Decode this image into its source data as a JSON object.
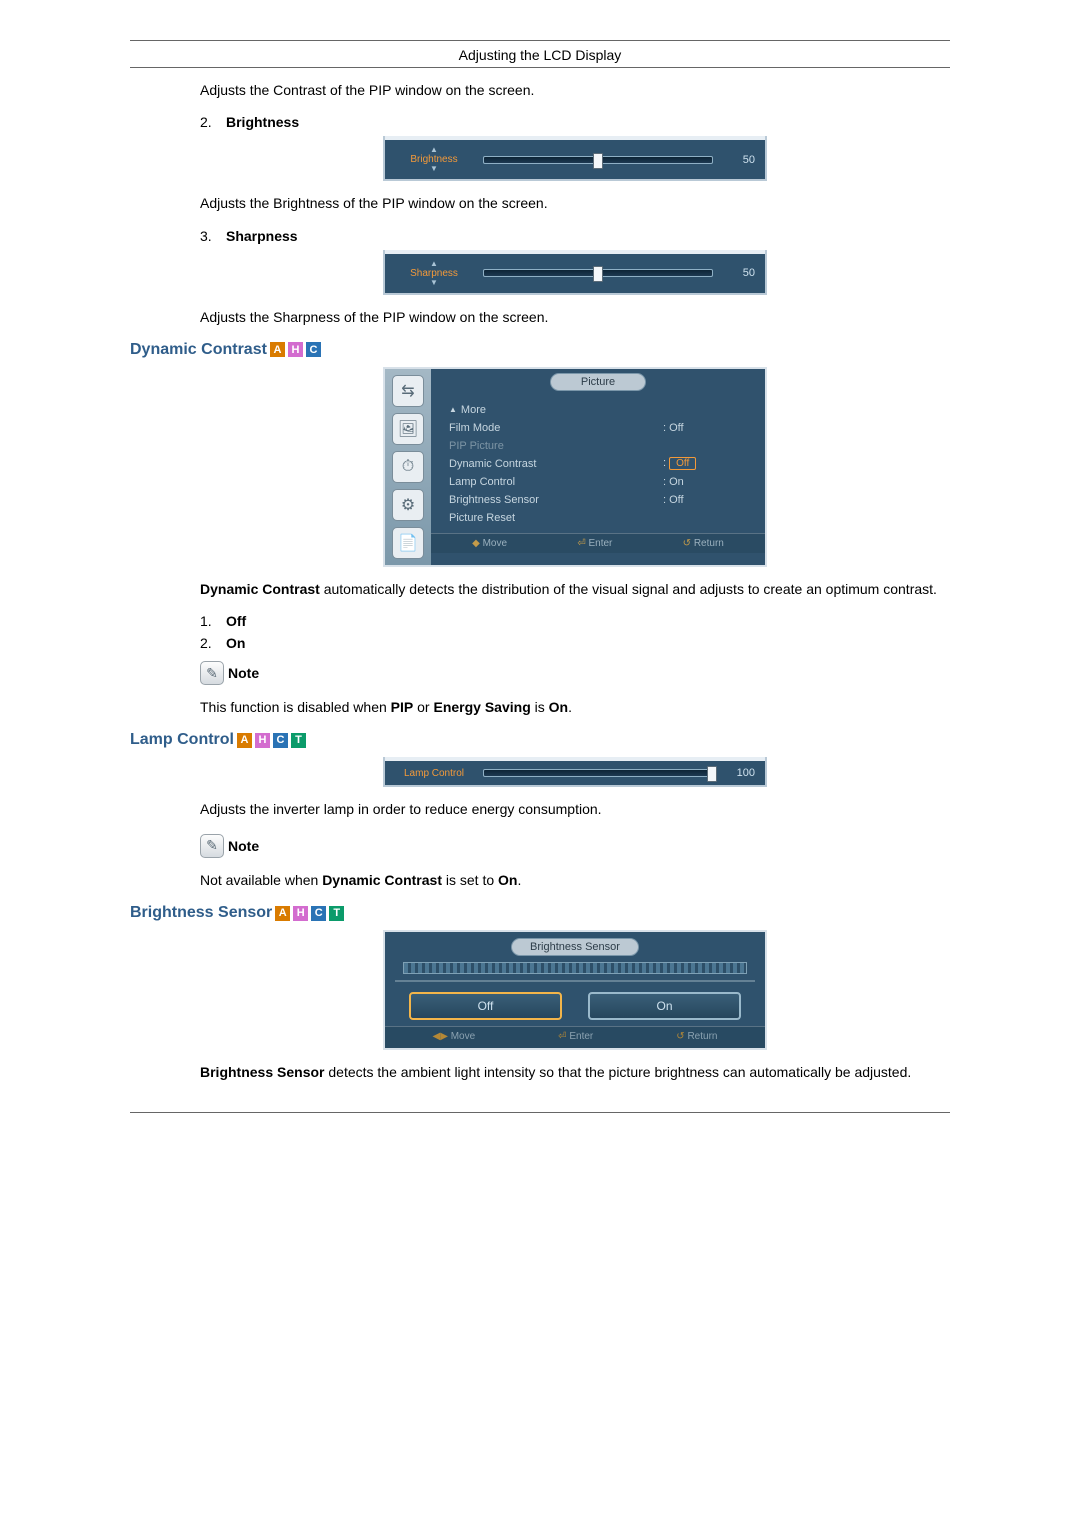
{
  "header": {
    "title": "Adjusting the LCD Display"
  },
  "contrast_para": "Adjusts the Contrast of the PIP window on the screen.",
  "item2": {
    "num": "2.",
    "label": "Brightness"
  },
  "brightness_slider": {
    "label": "Brightness",
    "value": "50",
    "pos_pct": 50
  },
  "brightness_para": "Adjusts the Brightness of the PIP window on the screen.",
  "item3": {
    "num": "3.",
    "label": "Sharpness"
  },
  "sharpness_slider": {
    "label": "Sharpness",
    "value": "50",
    "pos_pct": 50
  },
  "sharpness_para": "Adjusts the Sharpness of the PIP window on the screen.",
  "dyn": {
    "heading": "Dynamic Contrast",
    "badges": [
      "A",
      "H",
      "C"
    ],
    "menu": {
      "tab": "Picture",
      "rows": [
        {
          "label": "More",
          "value": null,
          "back": true
        },
        {
          "label": "Film Mode",
          "value": "Off"
        },
        {
          "label": "PIP Picture",
          "value": null,
          "dim": true
        },
        {
          "label": "Dynamic Contrast",
          "value": "Off",
          "cursor": true
        },
        {
          "label": "Lamp Control",
          "value": "On"
        },
        {
          "label": "Brightness Sensor",
          "value": "Off"
        },
        {
          "label": "Picture Reset",
          "value": null
        }
      ],
      "hints": {
        "move": "Move",
        "enter": "Enter",
        "return": "Return"
      }
    },
    "desc_bold": "Dynamic Contrast",
    "desc_rest": " automatically detects the distribution of the visual signal and adjusts to create an optimum contrast.",
    "opts": [
      {
        "num": "1.",
        "label": "Off"
      },
      {
        "num": "2.",
        "label": "On"
      }
    ],
    "note_label": "Note",
    "note_text_a": "This function is disabled when ",
    "note_b1": "PIP",
    "note_mid": " or ",
    "note_b2": "Energy Saving",
    "note_text_b": " is ",
    "note_b3": "On",
    "note_end": "."
  },
  "lamp": {
    "heading": "Lamp Control",
    "badges": [
      "A",
      "H",
      "C",
      "T"
    ],
    "slider": {
      "label": "Lamp Control",
      "value": "100",
      "pos_pct": 100
    },
    "para": "Adjusts the inverter lamp in order to reduce energy consumption.",
    "note_label": "Note",
    "note_text_a": "Not available when ",
    "note_b1": "Dynamic Contrast",
    "note_text_b": " is set to ",
    "note_b2": "On",
    "note_end": "."
  },
  "bs": {
    "heading": "Brightness Sensor ",
    "badges": [
      "A",
      "H",
      "C",
      "T"
    ],
    "panel": {
      "tab": "Brightness Sensor",
      "off": "Off",
      "on": "On",
      "hints": {
        "move": "Move",
        "enter": "Enter",
        "return": "Return"
      }
    },
    "desc_bold": "Brightness Sensor",
    "desc_rest": " detects the ambient light intensity so that the picture brightness can automatically be adjusted."
  }
}
